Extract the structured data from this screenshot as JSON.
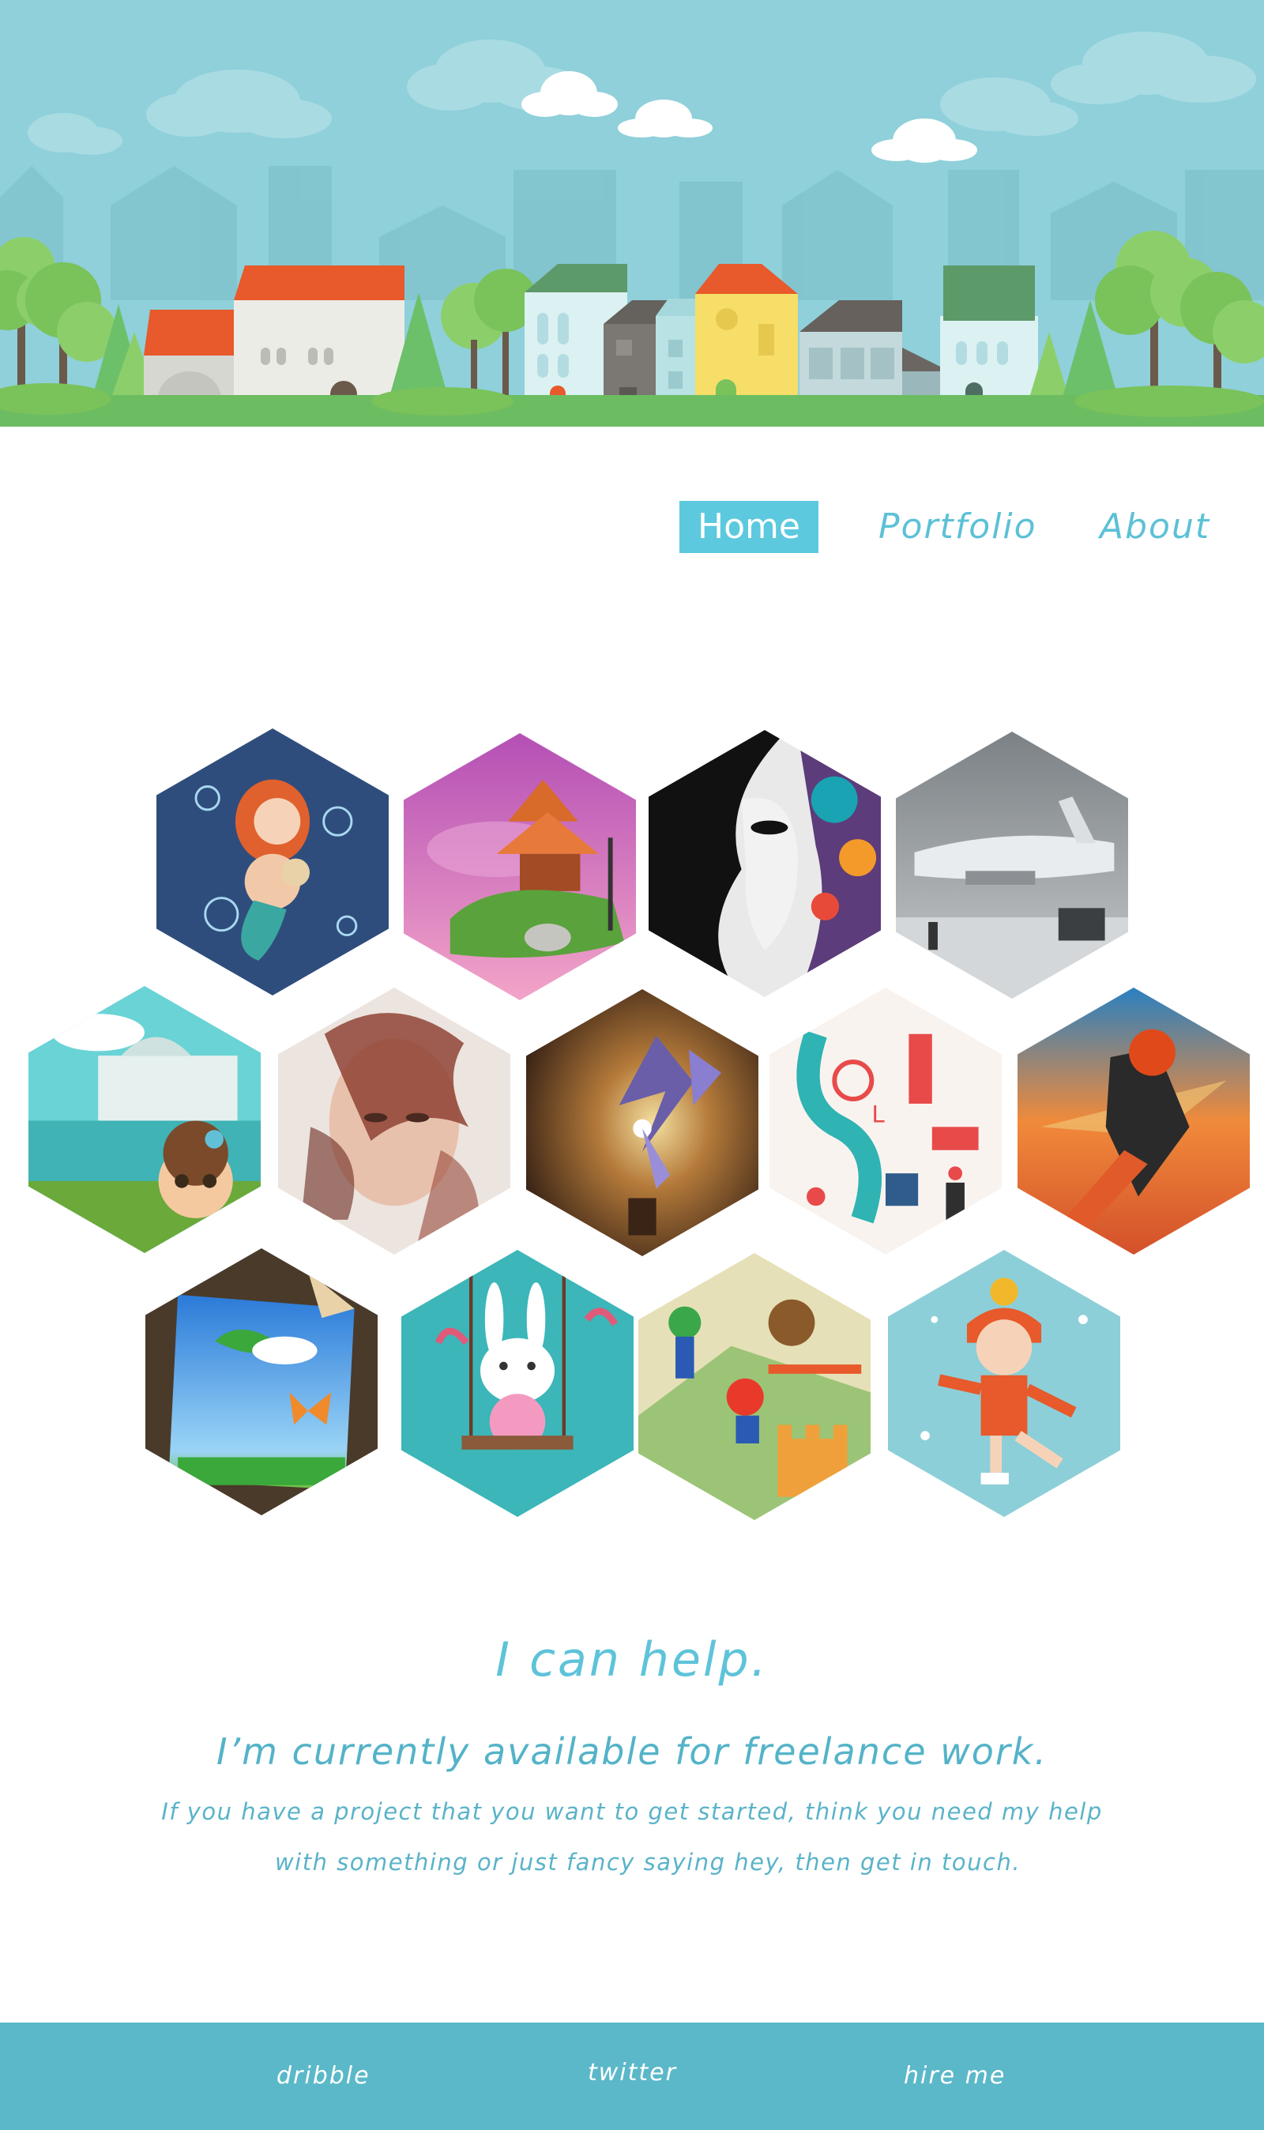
{
  "nav": {
    "home_label": "Home",
    "portfolio_label": "Portfolio",
    "about_label": "About"
  },
  "gallery": {
    "items": [
      {
        "subject": "mermaid-with-bubbles"
      },
      {
        "subject": "floating-pagoda-island"
      },
      {
        "subject": "abstract-face-portrait"
      },
      {
        "subject": "air-transat-airplane"
      },
      {
        "subject": "girl-by-lake-town"
      },
      {
        "subject": "double-exposure-portrait"
      },
      {
        "subject": "blue-dragon"
      },
      {
        "subject": "london-illustration"
      },
      {
        "subject": "flying-warrior-girl"
      },
      {
        "subject": "butterfly-frame"
      },
      {
        "subject": "bunny-on-swing"
      },
      {
        "subject": "mario-game-scene"
      },
      {
        "subject": "ice-skating-girl"
      }
    ]
  },
  "help": {
    "heading": "I can help.",
    "subheading": "I’m currently available for freelance work.",
    "paragraph_line1": "If you have a project that you want to get started, think you need my help",
    "paragraph_line2": "with something or just fancy saying hey, then get in touch."
  },
  "footer": {
    "dribble_label": "dribble",
    "twitter_label": "twitter",
    "hire_label": "hire me"
  },
  "colors": {
    "accent": "#5cc9de",
    "text": "#5ab9cf",
    "footer_bg": "#5bb8c9",
    "sky": "#8fd0da"
  }
}
